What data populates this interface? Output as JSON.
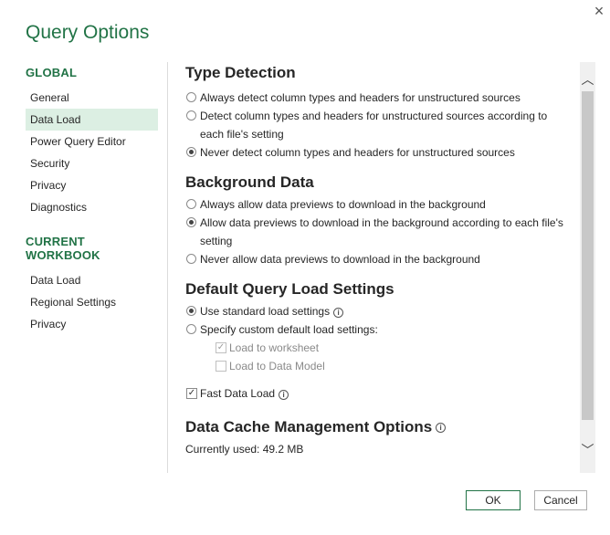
{
  "dialog": {
    "title": "Query Options",
    "close_icon": "×"
  },
  "sidebar": {
    "global_header": "GLOBAL",
    "global_items": [
      {
        "label": "General"
      },
      {
        "label": "Data Load",
        "selected": true
      },
      {
        "label": "Power Query Editor"
      },
      {
        "label": "Security"
      },
      {
        "label": "Privacy"
      },
      {
        "label": "Diagnostics"
      }
    ],
    "workbook_header": "CURRENT WORKBOOK",
    "workbook_items": [
      {
        "label": "Data Load"
      },
      {
        "label": "Regional Settings"
      },
      {
        "label": "Privacy"
      }
    ]
  },
  "type_detection": {
    "title": "Type Detection",
    "opt1": "Always detect column types and headers for unstructured sources",
    "opt2": "Detect column types and headers for unstructured sources according to each file's setting",
    "opt3": "Never detect column types and headers for unstructured sources",
    "selected": 3
  },
  "background_data": {
    "title": "Background Data",
    "opt1": "Always allow data previews to download in the background",
    "opt2": "Allow data previews to download in the background according to each file's setting",
    "opt3": "Never allow data previews to download in the background",
    "selected": 2
  },
  "load_settings": {
    "title": "Default Query Load Settings",
    "standard": "Use standard load settings",
    "custom": "Specify custom default load settings:",
    "worksheet": "Load to worksheet",
    "data_model": "Load to Data Model",
    "fast_load": "Fast Data Load",
    "info_glyph": "i"
  },
  "cache": {
    "title": "Data Cache Management Options",
    "currently_used": "Currently used: 49.2 MB"
  },
  "scrollbar": {
    "up_icon": "︿",
    "down_icon": "﹀"
  },
  "buttons": {
    "ok": "OK",
    "cancel": "Cancel"
  },
  "colors": {
    "accent": "#217346",
    "selected_bg": "#dcefe3"
  }
}
